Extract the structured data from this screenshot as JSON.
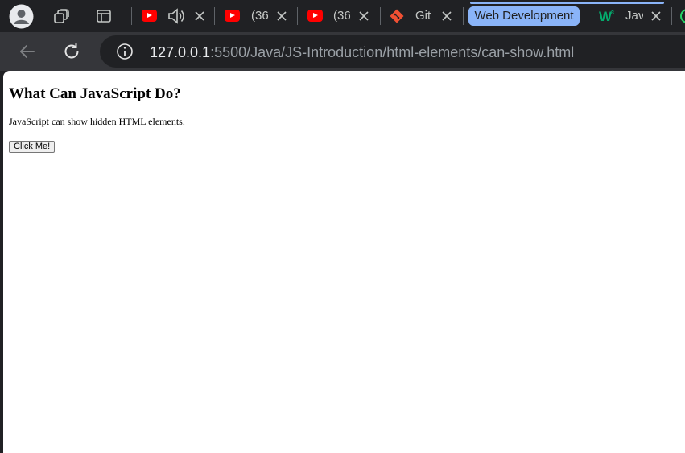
{
  "browser": {
    "tabs": [
      {
        "title": "",
        "icon": "youtube-icon",
        "audio": true
      },
      {
        "title": "(36",
        "icon": "youtube-icon"
      },
      {
        "title": "(36",
        "icon": "youtube-icon"
      },
      {
        "title": "Git",
        "icon": "git-icon"
      },
      {
        "title": "Jav",
        "icon": "w3schools-icon",
        "group": "Web Development"
      }
    ],
    "tab_group": {
      "label": "Web Development",
      "color": "#8ab4f8"
    },
    "url": {
      "host": "127.0.0.1",
      "path": ":5500/Java/JS-Introduction/html-elements/can-show.html"
    }
  },
  "page": {
    "heading": "What Can JavaScript Do?",
    "paragraph": "JavaScript can show hidden HTML elements.",
    "button_label": "Click Me!"
  },
  "colors": {
    "tabstrip_bg": "#202124",
    "toolbar_bg": "#35363a",
    "accent": "#8ab4f8",
    "youtube_red": "#ff0000",
    "git_orange": "#f05033",
    "w3_green": "#04aa6d"
  }
}
